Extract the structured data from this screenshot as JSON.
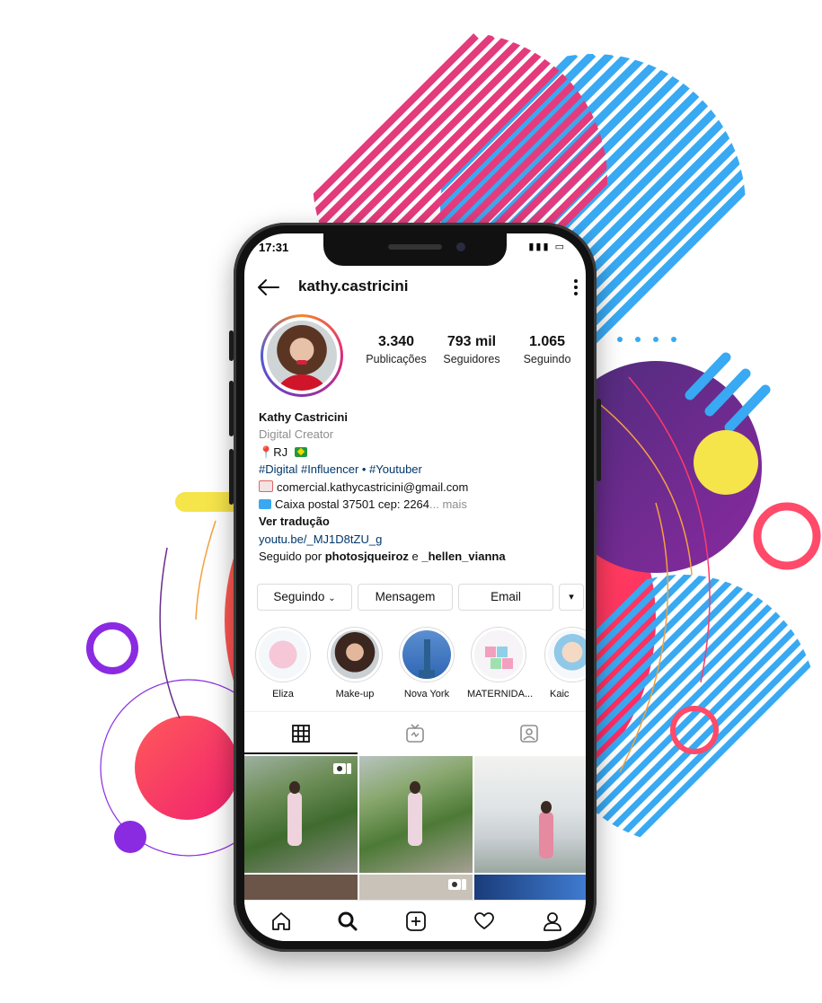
{
  "status": {
    "time": "17:31"
  },
  "profile": {
    "username": "kathy.castricini",
    "stats": [
      {
        "value": "3.340",
        "label": "Publicações"
      },
      {
        "value": "793 mil",
        "label": "Seguidores"
      },
      {
        "value": "1.065",
        "label": "Seguindo"
      }
    ],
    "name": "Kathy Castricini",
    "category": "Digital Creator",
    "location": "RJ",
    "hashtags": "#Digital #Influencer • #Youtuber",
    "email_line": "comercial.kathycastricini@gmail.com",
    "postal_line": "Caixa postal 37501 cep: 2264",
    "more": "... mais",
    "translate": "Ver tradução",
    "link": "youtu.be/_MJ1D8tZU_g",
    "followed_prefix": "Seguido por ",
    "followed_a": "photosjqueiroz",
    "followed_mid": " e ",
    "followed_b": "_hellen_vianna"
  },
  "actions": {
    "following": "Seguindo",
    "message": "Mensagem",
    "email": "Email",
    "dropdown": "▾"
  },
  "highlights": [
    {
      "label": "Eliza"
    },
    {
      "label": "Make-up"
    },
    {
      "label": "Nova York"
    },
    {
      "label": "MATERNIDA..."
    },
    {
      "label": "Kaic"
    }
  ],
  "tabs": [
    "grid-icon",
    "igtv-icon",
    "tagged-icon"
  ],
  "nav": [
    "home-icon",
    "search-icon",
    "new-post-icon",
    "activity-icon",
    "profile-icon"
  ],
  "colors": {
    "link": "#00376b",
    "muted": "#8e8e8e",
    "pink": "#e43b7d",
    "blue": "#3aa8f0",
    "purple": "#6a2b8c",
    "yellow": "#f5e44a"
  }
}
